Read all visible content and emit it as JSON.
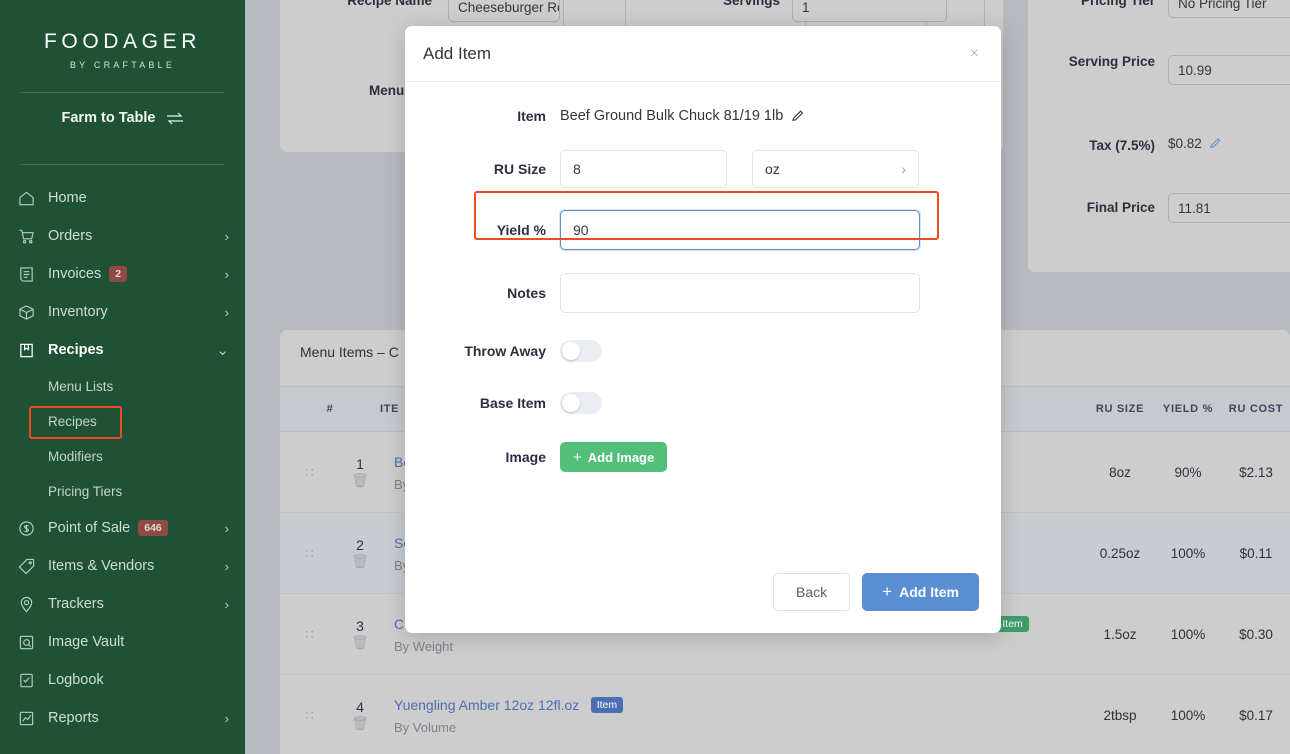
{
  "brand": {
    "name": "FOODAGER",
    "tagline": "BY CRAFTABLE"
  },
  "sidebar": {
    "location": "Farm to Table",
    "items": [
      {
        "label": "Home",
        "icon": "home-icon",
        "chevron": "",
        "badge": ""
      },
      {
        "label": "Orders",
        "icon": "cart-icon",
        "chevron": "›",
        "badge": ""
      },
      {
        "label": "Invoices",
        "icon": "invoice-icon",
        "chevron": "›",
        "badge": "2"
      },
      {
        "label": "Inventory",
        "icon": "box-icon",
        "chevron": "›",
        "badge": ""
      },
      {
        "label": "Recipes",
        "icon": "book-icon",
        "chevron": "⌄",
        "badge": ""
      }
    ],
    "sub_items": [
      {
        "label": "Menu Lists"
      },
      {
        "label": "Recipes"
      },
      {
        "label": "Modifiers"
      },
      {
        "label": "Pricing Tiers"
      }
    ],
    "items_after": [
      {
        "label": "Point of Sale",
        "icon": "dollar-icon",
        "chevron": "›",
        "badge": "646"
      },
      {
        "label": "Items & Vendors",
        "icon": "tag-icon",
        "chevron": "›",
        "badge": ""
      },
      {
        "label": "Trackers",
        "icon": "pin-icon",
        "chevron": "›",
        "badge": ""
      },
      {
        "label": "Image Vault",
        "icon": "vault-icon",
        "chevron": "",
        "badge": ""
      },
      {
        "label": "Logbook",
        "icon": "logbook-icon",
        "chevron": "",
        "badge": ""
      },
      {
        "label": "Reports",
        "icon": "chart-icon",
        "chevron": "›",
        "badge": ""
      }
    ],
    "accent_highlight": "#f04a20",
    "background": "#1f5137"
  },
  "recipe_header": {
    "recipe_name_label": "Recipe Name",
    "recipe_name_value": "Cheeseburger Royale",
    "servings_label": "Servings",
    "servings_value": "1",
    "menu_list_label": "Menu List"
  },
  "pricing": {
    "pricing_tier_label": "Pricing Tier",
    "pricing_tier_value": "No Pricing Tier",
    "serving_price_label": "Serving Price",
    "serving_price_value": "10.99",
    "tax_label": "Tax (7.5%)",
    "tax_value": "$0.82",
    "final_price_label": "Final Price",
    "final_price_value": "11.81"
  },
  "menu_items": {
    "title": "Menu Items – C",
    "columns": [
      "#",
      "ITE",
      "RU SIZE",
      "YIELD %",
      "RU COST"
    ],
    "rows": [
      {
        "num": "1",
        "name": "Bee",
        "subtitle": "By",
        "badge": "",
        "badge_color": "",
        "ru_size": "8oz",
        "yield": "90%",
        "ru_cost": "$2.13"
      },
      {
        "num": "2",
        "name": "Sea",
        "subtitle": "By",
        "badge": "",
        "badge_color": "",
        "ru_size": "0.25oz",
        "yield": "100%",
        "ru_cost": "$0.11"
      },
      {
        "num": "3",
        "name": "Ch",
        "subtitle": "By Weight",
        "badge": "Item",
        "badge_color": "#3f9c6d",
        "ru_size": "1.5oz",
        "yield": "100%",
        "ru_cost": "$0.30"
      },
      {
        "num": "4",
        "name": "Yuengling Amber 12oz 12fl.oz",
        "subtitle": "By Volume",
        "badge": "Item",
        "badge_color": "#4a6fb5",
        "ru_size": "2tbsp",
        "yield": "100%",
        "ru_cost": "$0.17"
      }
    ]
  },
  "modal": {
    "title": "Add Item",
    "close_label": "×",
    "item_label": "Item",
    "item_value": "Beef Ground Bulk Chuck 81/19 1lb",
    "ru_size_label": "RU Size",
    "ru_size_value": "8",
    "ru_unit_value": "oz",
    "ru_unit_chevron": "›",
    "yield_label": "Yield %",
    "yield_value": "90",
    "notes_label": "Notes",
    "notes_value": "",
    "notes_placeholder": "",
    "throw_away_label": "Throw Away",
    "throw_away_state": "off",
    "base_item_label": "Base Item",
    "base_item_state": "off",
    "image_label": "Image",
    "add_image_label": "Add Image",
    "add_image_plus": "+",
    "back_label": "Back",
    "add_item_label": "Add Item",
    "add_item_plus": "+",
    "green": "#52c07a",
    "blue": "#5b8fd4"
  }
}
